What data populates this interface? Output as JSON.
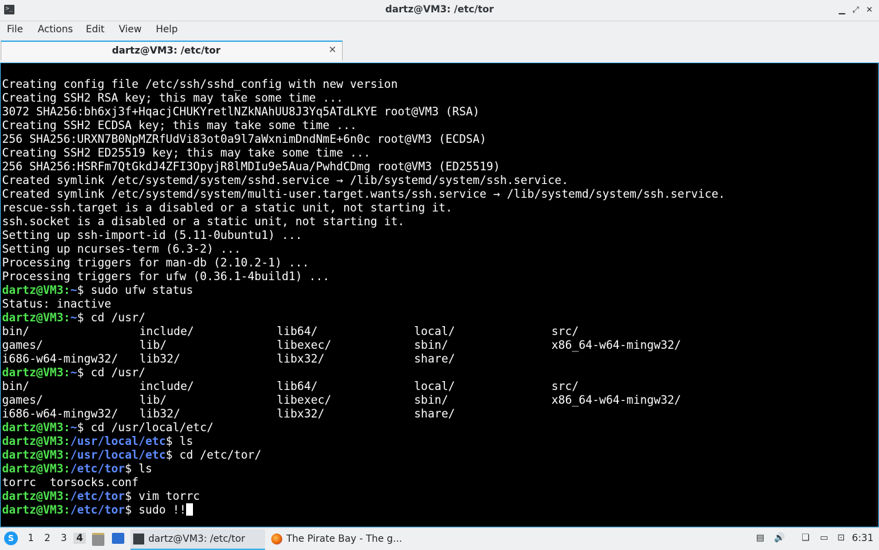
{
  "window": {
    "title": "dartz@VM3: /etc/tor",
    "minimize_glyph": "▁",
    "maximize_glyph": "⤢",
    "close_glyph": "✕",
    "app_icon_glyph": ">_"
  },
  "menu": {
    "file": "File",
    "actions": "Actions",
    "edit": "Edit",
    "view": "View",
    "help": "Help"
  },
  "tab": {
    "title": "dartz@VM3: /etc/tor",
    "close_glyph": "✕"
  },
  "terminal": {
    "lines": [
      "Creating config file /etc/ssh/sshd_config with new version",
      "Creating SSH2 RSA key; this may take some time ...",
      "3072 SHA256:bh6xj3f+HqacjCHUKYretlNZkNAhUU8J3Yq5ATdLKYE root@VM3 (RSA)",
      "Creating SSH2 ECDSA key; this may take some time ...",
      "256 SHA256:URXN7B0NpMZRfUdVi83ot0a9l7aWxnimDndNmE+6n0c root@VM3 (ECDSA)",
      "Creating SSH2 ED25519 key; this may take some time ...",
      "256 SHA256:HSRFm7QtGkdJ4ZFI3OpyjR8lMDIu9e5Aua/PwhdCDmg root@VM3 (ED25519)",
      "Created symlink /etc/systemd/system/sshd.service → /lib/systemd/system/ssh.service.",
      "Created symlink /etc/systemd/system/multi-user.target.wants/ssh.service → /lib/systemd/system/ssh.service.",
      "rescue-ssh.target is a disabled or a static unit, not starting it.",
      "ssh.socket is a disabled or a static unit, not starting it.",
      "Setting up ssh-import-id (5.11-0ubuntu1) ...",
      "Setting up ncurses-term (6.3-2) ...",
      "Processing triggers for man-db (2.10.2-1) ...",
      "Processing triggers for ufw (0.36.1-4build1) ..."
    ],
    "prompt_user": "dartz@VM3",
    "cmd1": {
      "path": "~",
      "command": " sudo ufw status"
    },
    "status_line": "Status: inactive",
    "cmd2": {
      "path": "~",
      "command": " cd /usr/"
    },
    "ls_usr": [
      [
        "bin/",
        "include/",
        "lib64/",
        "local/",
        "src/"
      ],
      [
        "games/",
        "lib/",
        "libexec/",
        "sbin/",
        "x86_64-w64-mingw32/"
      ],
      [
        "i686-w64-mingw32/",
        "lib32/",
        "libx32/",
        "share/",
        ""
      ]
    ],
    "cmd3": {
      "path": "~",
      "command": " cd /usr/"
    },
    "cmd4": {
      "path": "~",
      "command": " cd /usr/local/etc/"
    },
    "cmd5": {
      "path": "/usr/local/etc",
      "command": " ls"
    },
    "cmd6": {
      "path": "/usr/local/etc",
      "command": " cd /etc/tor/"
    },
    "cmd7": {
      "path": "/etc/tor",
      "command": " ls"
    },
    "ls_tor": "torrc  torsocks.conf",
    "cmd8": {
      "path": "/etc/tor",
      "command": " vim torrc"
    },
    "cmd9": {
      "path": "/etc/tor",
      "command": " sudo !!"
    }
  },
  "taskbar": {
    "workspaces": [
      "1",
      "2",
      "3",
      "4"
    ],
    "active_workspace": "4",
    "tasks": [
      {
        "label": "dartz@VM3: /etc/tor",
        "icon": "terminal-icon"
      },
      {
        "label": "The Pirate Bay - The g...",
        "icon": "firefox-icon"
      }
    ],
    "clock": "6:31",
    "start_glyph": "S"
  },
  "colors": {
    "prompt_user": "#4fe34f",
    "prompt_path": "#5d8bff",
    "accent": "#3daee9"
  }
}
